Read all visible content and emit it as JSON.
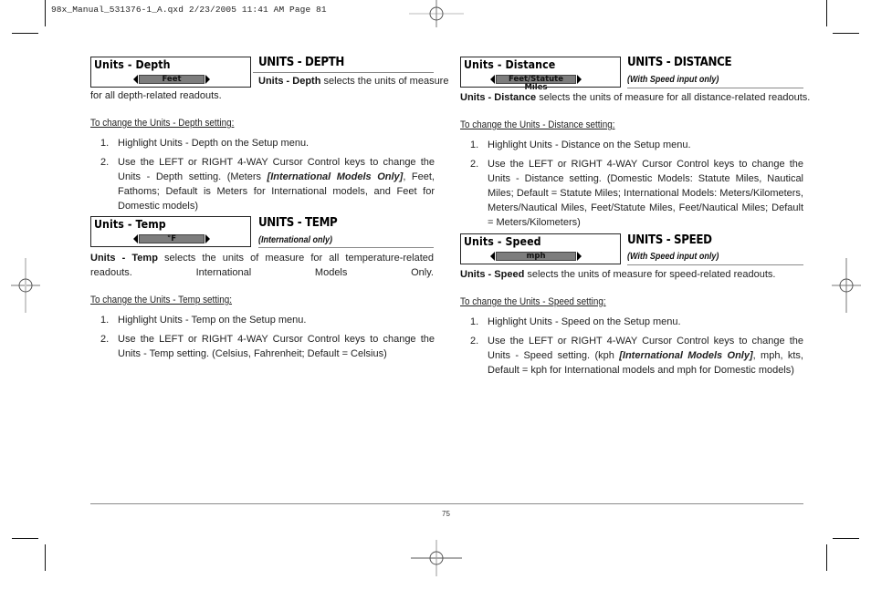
{
  "slug": "98x_Manual_531376-1_A.qxd  2/23/2005  11:41 AM  Page 81",
  "page_number": "75",
  "sections": {
    "depth": {
      "menu_title": "Units - Depth",
      "menu_value": "Feet",
      "title": "UNITS - DEPTH",
      "subtitle": "",
      "desc_bold": "Units - Depth",
      "desc_rest": " selects the units of measure for all depth-related readouts.",
      "how_to": "To change the Units - Depth setting:",
      "steps": [
        {
          "num": "1.",
          "text": "Highlight Units - Depth on the Setup menu."
        },
        {
          "num": "2.",
          "text_before": "Use the LEFT or RIGHT 4-WAY Cursor Control keys to change the Units - Depth setting. (Meters ",
          "emphasis": "[International Models Only]",
          "text_after": ", Feet, Fathoms; Default is Meters for International models, and Feet for Domestic models)"
        }
      ]
    },
    "temp": {
      "menu_title": "Units - Temp",
      "menu_value": "°F",
      "title": "UNITS - TEMP",
      "subtitle": "(International only)",
      "desc_bold": "Units - Temp",
      "desc_rest": " selects the units of measure for all temperature-related readouts. International Models Only.",
      "how_to": "To change the Units - Temp setting:",
      "steps": [
        {
          "num": "1.",
          "text": "Highlight Units - Temp on the Setup menu."
        },
        {
          "num": "2.",
          "text": "Use the LEFT or RIGHT 4-WAY Cursor Control keys to change the Units - Temp setting. (Celsius, Fahrenheit; Default = Celsius)"
        }
      ]
    },
    "distance": {
      "menu_title": "Units - Distance",
      "menu_value": "Feet/Statute Miles",
      "title": "UNITS - DISTANCE",
      "subtitle": "(With Speed input only)",
      "desc_bold": "Units - Distance",
      "desc_rest": " selects the units of measure for all distance-related readouts.",
      "how_to": "To change the Units - Distance setting:",
      "steps": [
        {
          "num": "1.",
          "text": "Highlight Units - Distance on the Setup menu."
        },
        {
          "num": "2.",
          "text": "Use the LEFT or RIGHT 4-WAY Cursor Control keys to change the Units - Distance setting. (Domestic Models: Statute Miles, Nautical Miles; Default = Statute Miles; International Models: Meters/Kilometers, Meters/Nautical Miles, Feet/Statute Miles, Feet/Nautical Miles; Default = Meters/Kilometers)"
        }
      ]
    },
    "speed": {
      "menu_title": "Units - Speed",
      "menu_value": "mph",
      "title": "UNITS - SPEED",
      "subtitle": "(With Speed input only)",
      "desc_bold": "Units - Speed",
      "desc_rest": " selects the units of measure for speed-related readouts.",
      "how_to": "To change the Units - Speed setting:",
      "steps": [
        {
          "num": "1.",
          "text": "Highlight Units - Speed on the Setup menu."
        },
        {
          "num": "2.",
          "text_before": "Use the LEFT or RIGHT 4-WAY Cursor Control keys to change the Units - Speed setting. (kph ",
          "emphasis": "[International Models Only]",
          "text_after": ", mph, kts, Default = kph for International models and mph for Domestic models)"
        }
      ]
    }
  }
}
